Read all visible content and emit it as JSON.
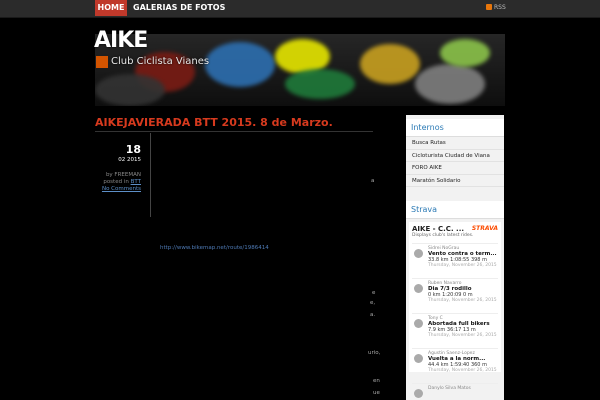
{
  "nav": {
    "home": "HOME",
    "galleries": "GALERIAS DE FOTOS",
    "rss": "RSS"
  },
  "header": {
    "logo": "AIKE",
    "tagline": "Club Ciclista Vianes"
  },
  "post": {
    "title": "AIKEJAVIERADA BTT 2015. 8 de Marzo.",
    "day": "18",
    "month": "02 2015",
    "by": "by FREEMAN",
    "posted_in": "posted in",
    "category": "BTT",
    "comments": "No Comments",
    "link": "http://www.bikemap.net/route/1986414",
    "fragments": [
      "a",
      "e",
      "e,",
      "a.",
      "urio,",
      "en",
      "ue"
    ]
  },
  "sidebar": {
    "internos": {
      "title": "Internos",
      "items": [
        "Busca Rutas",
        "Cicloturista Ciudad de Viana",
        "FORO AIKE",
        "Maratón Solidario"
      ]
    },
    "strava": {
      "title": "Strava",
      "club": "AIKE - C.C. ...",
      "subtitle": "Displays club's latest rides.",
      "logo": "STRAVA",
      "activities": [
        {
          "name": "Sidrei NoGrau",
          "title": "Vento contra o term...",
          "stats": "33.8 km   1:08:55   398 m",
          "date": "Thursday, November 26, 2015"
        },
        {
          "name": "Ruben Navarro",
          "title": "Dia 7/3 rodillo",
          "stats": "0 km   1:20:09   0 m",
          "date": "Thursday, November 26, 2015"
        },
        {
          "name": "Tony C",
          "title": "Abortada full bikers",
          "stats": "7.9 km   36:17   13 m",
          "date": "Thursday, November 26, 2015"
        },
        {
          "name": "Agustin Saenz-Lopez",
          "title": "Vuelta a la norm...",
          "stats": "44.4 km   1:59:40   360 m",
          "date": "Thursday, November 26, 2015"
        },
        {
          "name": "Danylo Silva Matos",
          "title": "",
          "stats": "",
          "date": ""
        }
      ]
    }
  }
}
